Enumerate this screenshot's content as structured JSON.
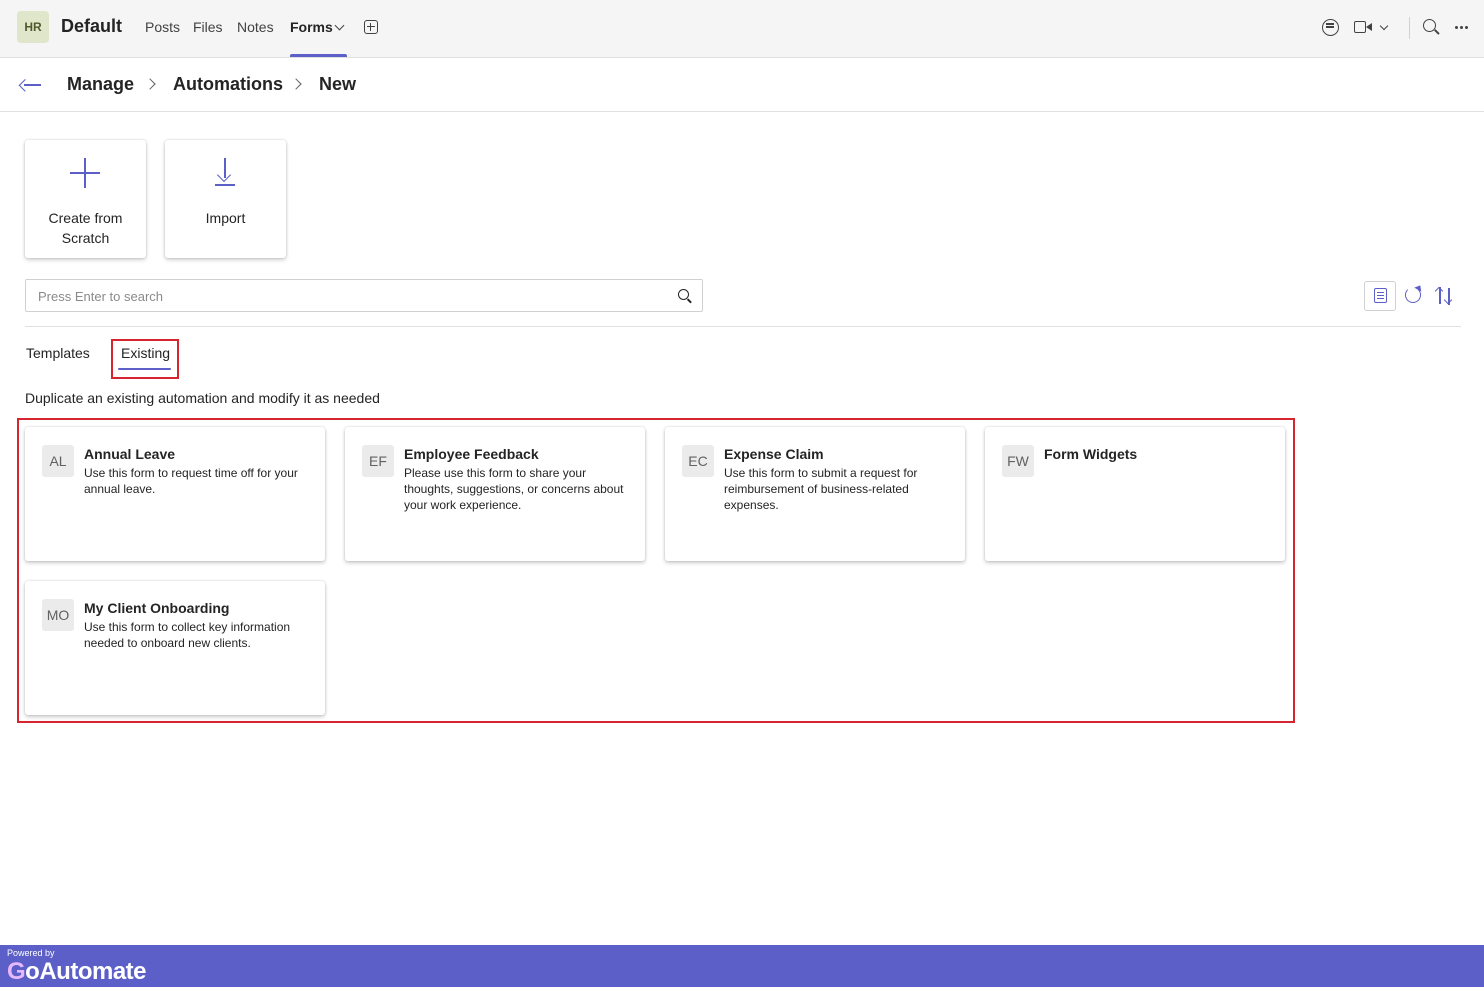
{
  "topbar": {
    "team_initials": "HR",
    "team_name": "Default",
    "tabs": [
      {
        "label": "Posts"
      },
      {
        "label": "Files"
      },
      {
        "label": "Notes"
      },
      {
        "label": "Forms"
      }
    ],
    "active_tab": "Forms"
  },
  "breadcrumb": {
    "items": [
      "Manage",
      "Automations",
      "New"
    ]
  },
  "actions": {
    "create_label": "Create from Scratch",
    "import_label": "Import"
  },
  "search": {
    "placeholder": "Press Enter to search",
    "value": ""
  },
  "tabs": {
    "templates": "Templates",
    "existing": "Existing",
    "active": "Existing"
  },
  "subtitle": "Duplicate an existing automation and modify it as needed",
  "cards": [
    {
      "initials": "AL",
      "title": "Annual Leave",
      "description": "Use this form to request time off for your annual leave."
    },
    {
      "initials": "EF",
      "title": "Employee Feedback",
      "description": "Please use this form to share your thoughts, suggestions, or concerns about your work experience."
    },
    {
      "initials": "EC",
      "title": "Expense Claim",
      "description": "Use this form to submit a request for reimbursement of business-related expenses."
    },
    {
      "initials": "FW",
      "title": "Form Widgets",
      "description": ""
    },
    {
      "initials": "MO",
      "title": "My Client Onboarding",
      "description": "Use this form to collect key information needed to onboard new clients."
    }
  ],
  "footer": {
    "powered_by": "Powered by",
    "brand_g": "G",
    "brand_rest": "oAutomate"
  },
  "colors": {
    "accent": "#5b5fc7",
    "highlight": "#d7252f"
  },
  "icons": [
    "chat-icon",
    "video-icon",
    "search-icon",
    "more-icon",
    "back-arrow-icon",
    "plus-icon",
    "download-icon",
    "list-icon",
    "refresh-icon",
    "sort-icon"
  ]
}
